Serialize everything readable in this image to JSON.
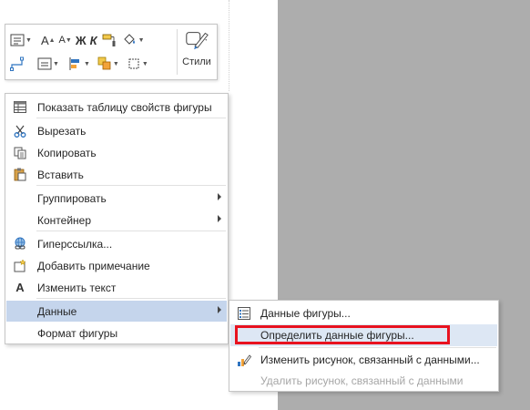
{
  "toolbar": {
    "styles_label": "Стили",
    "bold_glyph": "Ж",
    "italic_glyph": "К",
    "font_grow_glyph": "A",
    "font_shrink_glyph": "A"
  },
  "context_menu": {
    "items": [
      {
        "label": "Показать таблицу свойств фигуры",
        "icon": "table-icon"
      },
      {
        "label": "Вырезать",
        "icon": "scissors-icon"
      },
      {
        "label": "Копировать",
        "icon": "copy-icon"
      },
      {
        "label": "Вставить",
        "icon": "paste-icon"
      },
      {
        "label": "Группировать",
        "icon": "",
        "submenu": true
      },
      {
        "label": "Контейнер",
        "icon": "",
        "submenu": true
      },
      {
        "label": "Гиперссылка...",
        "icon": "hyperlink-icon"
      },
      {
        "label": "Добавить примечание",
        "icon": "comment-icon"
      },
      {
        "label": "Изменить текст",
        "icon": "text-a-icon"
      },
      {
        "label": "Данные",
        "icon": "",
        "submenu": true
      },
      {
        "label": "Формат фигуры",
        "icon": ""
      }
    ]
  },
  "data_submenu": {
    "items": [
      {
        "label": "Данные фигуры...",
        "icon": "shape-data-icon"
      },
      {
        "label": "Определить данные фигуры...",
        "icon": ""
      },
      {
        "label": "Изменить рисунок, связанный с данными...",
        "icon": "edit-graphic-icon"
      },
      {
        "label": "Удалить рисунок, связанный с данными",
        "icon": ""
      }
    ]
  },
  "colors": {
    "highlight": "#c5d5ec",
    "sub_highlight": "#dde7f4",
    "annotation_red": "#e8121f",
    "canvas_gray": "#adadad"
  }
}
